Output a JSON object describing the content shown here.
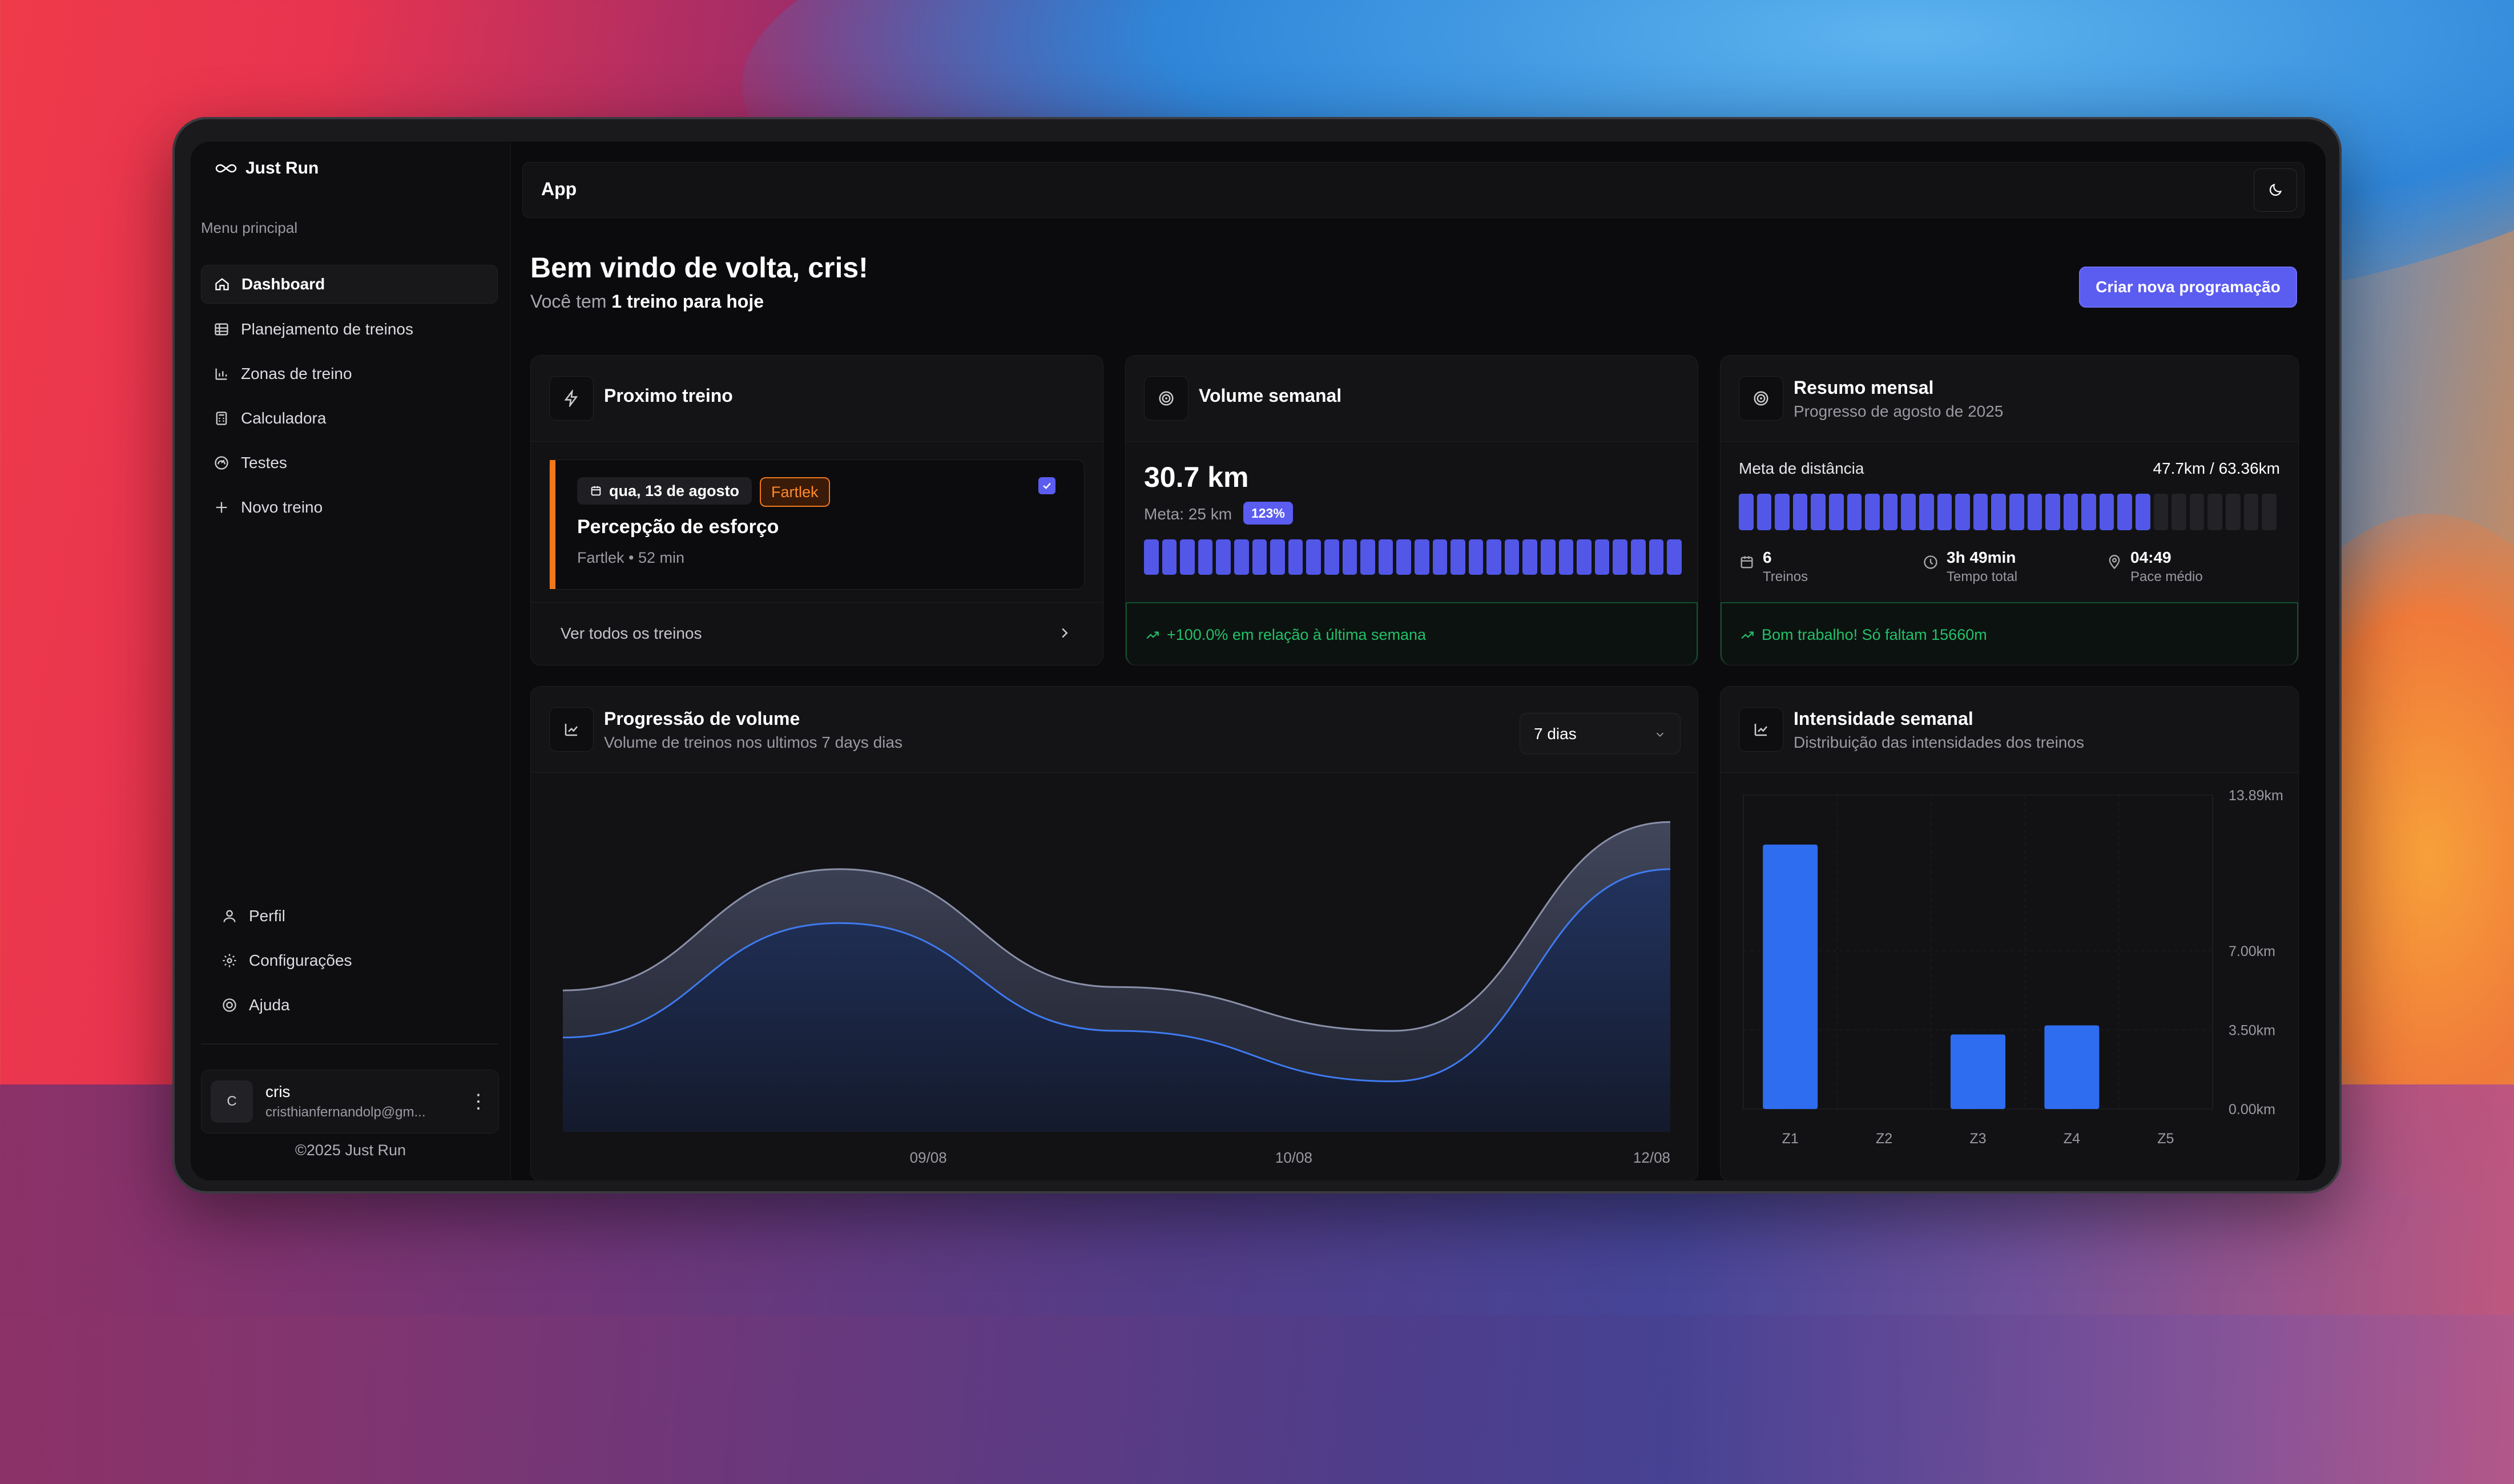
{
  "app": {
    "brand": "Just Run",
    "topbar_title": "App"
  },
  "sidebar": {
    "menu_title": "Menu principal",
    "items": [
      {
        "label": "Dashboard",
        "icon": "home-icon",
        "active": true
      },
      {
        "label": "Planejamento de treinos",
        "icon": "table-icon"
      },
      {
        "label": "Zonas de treino",
        "icon": "bar-chart-icon"
      },
      {
        "label": "Calculadora",
        "icon": "calculator-icon"
      },
      {
        "label": "Testes",
        "icon": "gauge-icon"
      },
      {
        "label": "Novo treino",
        "icon": "plus-icon"
      }
    ],
    "bottom_items": [
      {
        "label": "Perfil",
        "icon": "user-icon"
      },
      {
        "label": "Configurações",
        "icon": "gear-icon"
      },
      {
        "label": "Ajuda",
        "icon": "help-icon"
      }
    ],
    "user": {
      "initial": "C",
      "name": "cris",
      "email": "cristhianfernandolp@gm..."
    },
    "copyright": "©2025 Just Run"
  },
  "header": {
    "welcome": "Bem vindo de volta, cris!",
    "today_prefix": "Você tem",
    "today_bold": "1 treino para hoje",
    "create_button": "Criar nova programação"
  },
  "next_workout": {
    "title": "Proximo treino",
    "date": "qua, 13 de agosto",
    "type": "Fartlek",
    "name": "Percepção de esforço",
    "meta": "Fartlek • 52 min",
    "completed": true,
    "see_all": "Ver todos os treinos"
  },
  "weekly_volume": {
    "title": "Volume semanal",
    "value": "30.7 km",
    "goal": "Meta: 25 km",
    "badge": "123%",
    "progress": 1.0,
    "segments": 30,
    "trend": "+100.0% em relação à última semana"
  },
  "monthly_summary": {
    "title": "Resumo mensal",
    "subtitle": "Progresso de agosto de 2025",
    "distance_label": "Meta de distância",
    "distance_value": "47.7km / 63.36km",
    "progress": 0.753,
    "segments": 30,
    "stats": [
      {
        "value": "6",
        "label": "Treinos",
        "icon": "calendar-icon"
      },
      {
        "value": "3h 49min",
        "label": "Tempo total",
        "icon": "clock-icon"
      },
      {
        "value": "04:49",
        "label": "Pace médio",
        "icon": "pin-icon"
      }
    ],
    "trend": "Bom trabalho! Só faltam 15660m"
  },
  "volume_progression": {
    "title": "Progressão de volume",
    "subtitle": "Volume de treinos nos ultimos 7 days dias",
    "range": "7 dias"
  },
  "weekly_intensity": {
    "title": "Intensidade semanal",
    "subtitle": "Distribuição das intensidades dos treinos"
  },
  "chart_data": [
    {
      "type": "area",
      "title": "Progressão de volume",
      "x": [
        "09/08",
        "10/08",
        "12/08"
      ],
      "x_positions": [
        0.33,
        0.66,
        1.0
      ],
      "series": [
        {
          "values": [
            0.42,
            0.78,
            0.43,
            0.3,
            0.92
          ]
        },
        {
          "values": [
            0.28,
            0.62,
            0.3,
            0.15,
            0.78
          ]
        }
      ],
      "grid": false
    },
    {
      "type": "bar",
      "title": "Intensidade semanal",
      "categories": [
        "Z1",
        "Z2",
        "Z3",
        "Z4",
        "Z5"
      ],
      "values": [
        11.7,
        0,
        3.3,
        3.7,
        0
      ],
      "ylim": [
        0,
        13.89
      ],
      "ytick_labels": [
        "0.00km",
        "3.50km",
        "7.00km",
        "13.89km"
      ],
      "yticks": [
        0,
        3.5,
        7.0,
        13.89
      ],
      "bar_color": "#2f6df0",
      "grid": true
    }
  ],
  "colors": {
    "accent": "#5b5cf0",
    "success": "#24c06a",
    "fartlek": "#f0781c"
  }
}
